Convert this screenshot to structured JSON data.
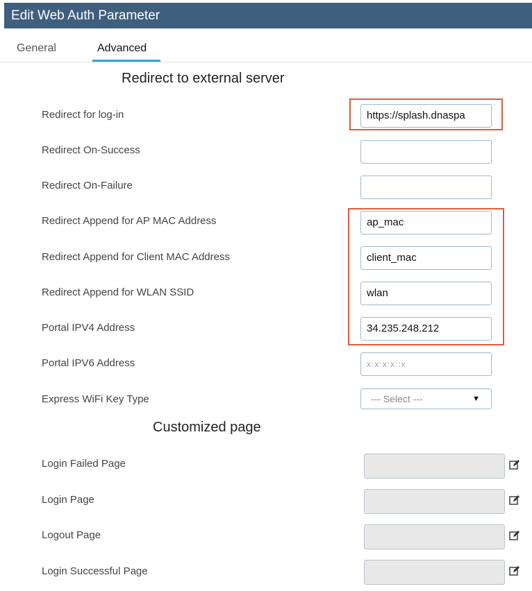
{
  "window": {
    "title": "Edit Web Auth Parameter"
  },
  "tabs": [
    {
      "label": "General",
      "active": false
    },
    {
      "label": "Advanced",
      "active": true
    }
  ],
  "sections": {
    "redirect_title": "Redirect to external server",
    "custom_title": "Customized page"
  },
  "redirect_fields": [
    {
      "label": "Redirect for log-in",
      "value": "https://splash.dnaspa",
      "highlighted": true
    },
    {
      "label": "Redirect On-Success",
      "value": ""
    },
    {
      "label": "Redirect On-Failure",
      "value": ""
    },
    {
      "label": "Redirect Append for AP MAC Address",
      "value": "ap_mac",
      "highlighted": true
    },
    {
      "label": "Redirect Append for Client MAC Address",
      "value": "client_mac",
      "highlighted": true
    },
    {
      "label": "Redirect Append for WLAN SSID",
      "value": "wlan",
      "highlighted": true
    },
    {
      "label": "Portal IPV4 Address",
      "value": "34.235.248.212",
      "highlighted": true
    },
    {
      "label": "Portal IPV6 Address",
      "value": "",
      "placeholder": "x:x:x:x::x"
    },
    {
      "label": "Express WiFi Key Type",
      "selected": "--- Select ---"
    }
  ],
  "custom_fields": [
    {
      "label": "Login Failed Page",
      "icon": "edit-icon"
    },
    {
      "label": "Login Page",
      "icon": "edit-icon"
    },
    {
      "label": "Logout Page",
      "icon": "edit-icon"
    },
    {
      "label": "Login Successful Page",
      "icon": "edit-icon"
    }
  ],
  "colors": {
    "titlebar": "#3f5f7f",
    "tab_accent": "#3aa0d8",
    "highlight": "#e05a3a",
    "field_border": "#9fb9cc"
  }
}
